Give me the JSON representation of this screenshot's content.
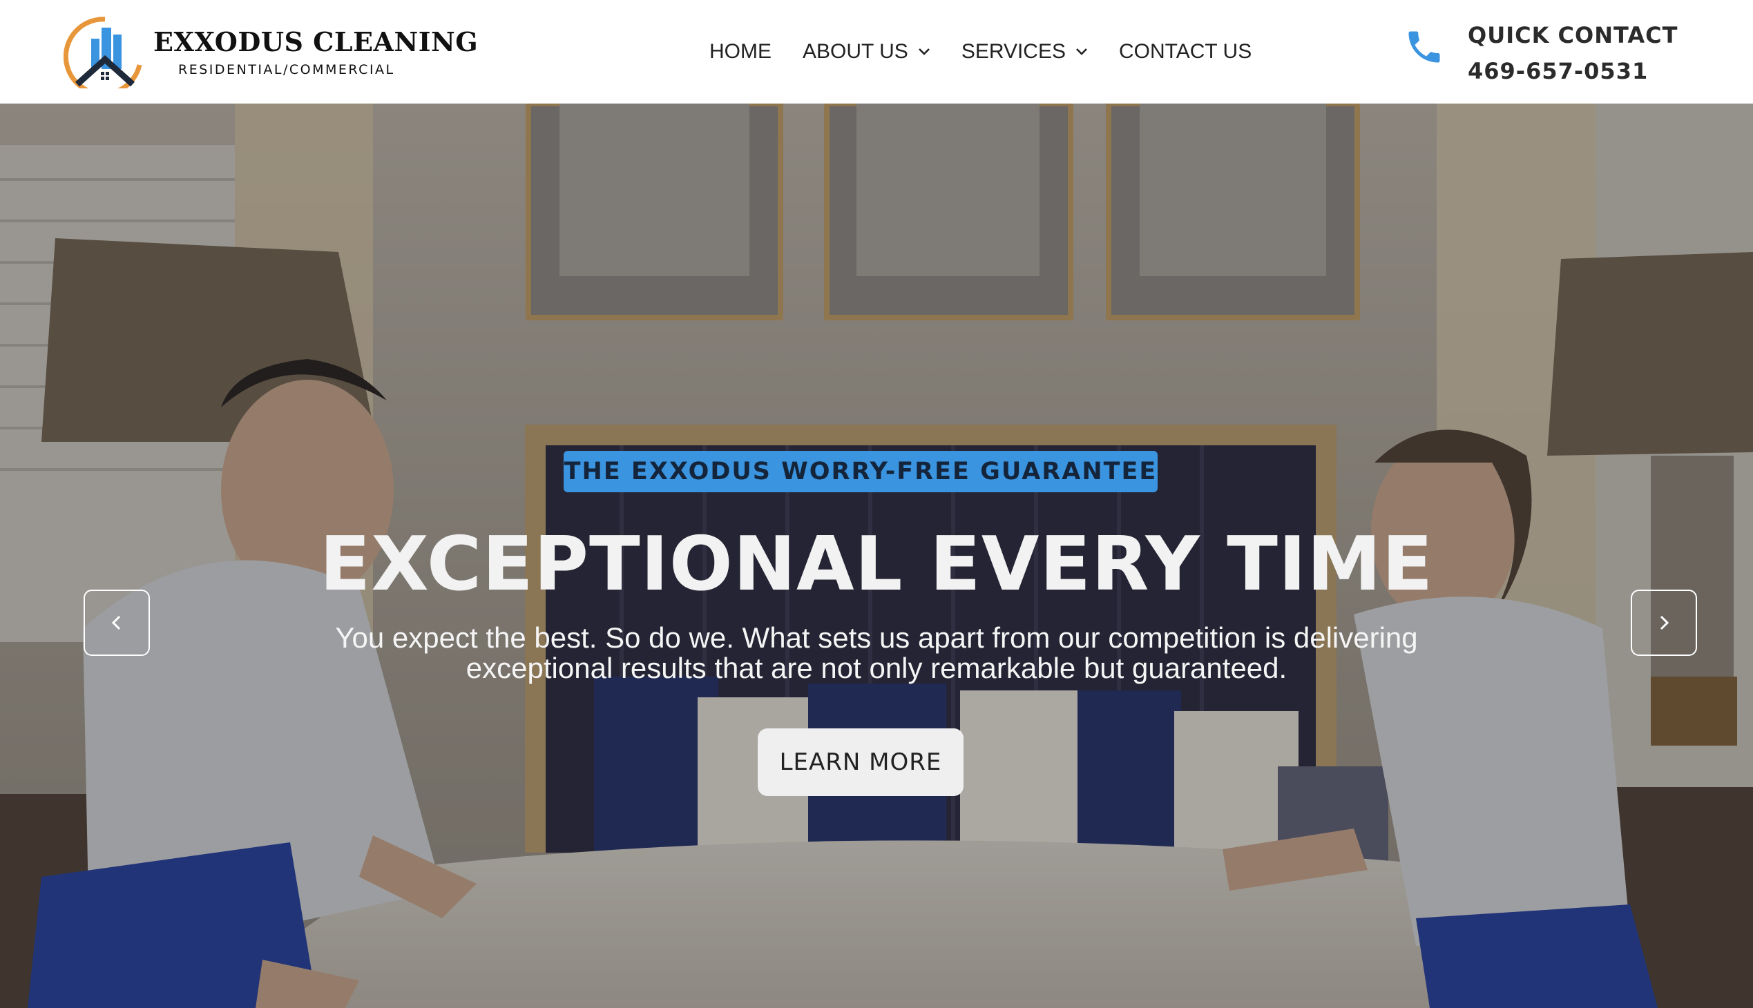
{
  "header": {
    "logo": {
      "name": "EXXODUS CLEANING",
      "tagline": "RESIDENTIAL/COMMERCIAL",
      "ring_color": "#e8963a",
      "building_color": "#3b94df",
      "roof_color": "#1e2a3a"
    },
    "nav": {
      "items": [
        {
          "label": "HOME",
          "has_dropdown": false
        },
        {
          "label": "ABOUT US",
          "has_dropdown": true
        },
        {
          "label": "SERVICES",
          "has_dropdown": true
        },
        {
          "label": "CONTACT US",
          "has_dropdown": false
        }
      ]
    },
    "quick_contact": {
      "icon": "phone-icon",
      "icon_color": "#3b94df",
      "label": "QUICK CONTACT",
      "phone": "469-657-0531"
    }
  },
  "hero": {
    "background": "photo of two cleaners making a bed in a bedroom with mirrors and lamps",
    "badge": "THE EXXODUS WORRY-FREE GUARANTEE",
    "badge_color": "#3b94df",
    "headline": "EXCEPTIONAL EVERY TIME",
    "subtext": "You expect the best. So do we. What sets us apart from our competition is delivering exceptional results that are not only remarkable but guaranteed.",
    "cta_label": "LEARN MORE",
    "prev_icon": "chevron-left-icon",
    "next_icon": "chevron-right-icon"
  }
}
